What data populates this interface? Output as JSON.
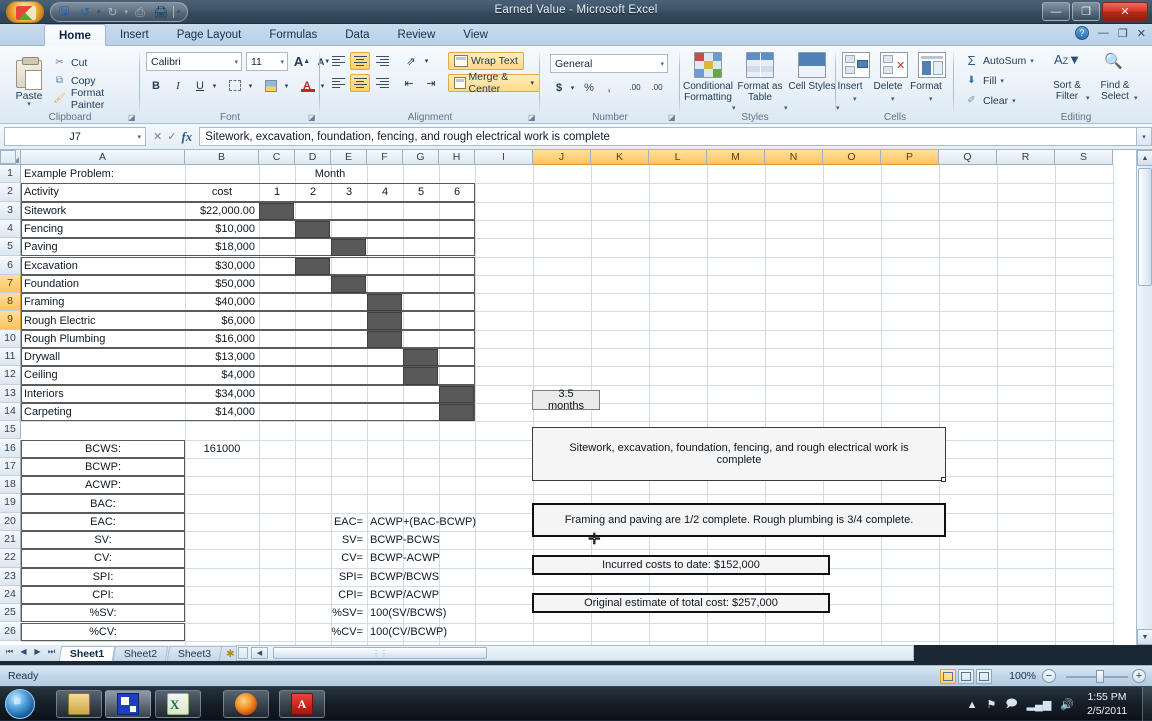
{
  "window": {
    "title": "Earned Value - Microsoft Excel",
    "minimize": "—",
    "restore": "❐",
    "close": "✕"
  },
  "quick_access": {
    "save": "💾",
    "undo": "↺",
    "redo": "↻",
    "print": "🖫",
    "customize": "▾"
  },
  "ribbon": {
    "tabs": [
      {
        "label": "Home",
        "active": true
      },
      {
        "label": "Insert",
        "active": false
      },
      {
        "label": "Page Layout",
        "active": false
      },
      {
        "label": "Formulas",
        "active": false
      },
      {
        "label": "Data",
        "active": false
      },
      {
        "label": "Review",
        "active": false
      },
      {
        "label": "View",
        "active": false
      }
    ],
    "help": "?",
    "minimize_ribbon": "—",
    "restore_window": "❐",
    "close_window": "✕",
    "groups": {
      "clipboard": {
        "name": "Clipboard",
        "paste": "Paste",
        "cut": "Cut",
        "copy": "Copy",
        "format_painter": "Format Painter"
      },
      "font": {
        "name": "Font",
        "font_family": "Calibri",
        "font_size": "11",
        "grow_font": "A",
        "shrink_font": "A",
        "bold": "B",
        "italic": "I",
        "underline": "U"
      },
      "alignment": {
        "name": "Alignment",
        "wrap_text": "Wrap Text",
        "merge_center": "Merge & Center"
      },
      "number": {
        "name": "Number",
        "format": "General",
        "currency": "$",
        "percent": "%",
        "comma": ",",
        "increase_decimal": ".00",
        "decrease_decimal": ".00"
      },
      "styles": {
        "name": "Styles",
        "conditional_formatting": "Conditional Formatting",
        "format_as_table": "Format as Table",
        "cell_styles": "Cell Styles"
      },
      "cells": {
        "name": "Cells",
        "insert": "Insert",
        "delete": "Delete",
        "format": "Format"
      },
      "editing": {
        "name": "Editing",
        "autosum": "AutoSum",
        "fill": "Fill",
        "clear": "Clear",
        "sort_filter": "Sort & Filter",
        "find_select": "Find & Select"
      }
    }
  },
  "formula_bar": {
    "name_box": "J7",
    "cancel": "✕",
    "enter": "✓",
    "insert_function": "fx",
    "content": "Sitework, excavation, foundation, fencing, and rough electrical work is complete",
    "expand": "▾"
  },
  "grid": {
    "columns": [
      "A",
      "B",
      "C",
      "D",
      "E",
      "F",
      "G",
      "H",
      "I",
      "J",
      "K",
      "L",
      "M",
      "N",
      "O",
      "P",
      "Q",
      "R",
      "S"
    ],
    "selected_columns": [
      "J",
      "K",
      "L",
      "M",
      "N",
      "O",
      "P"
    ],
    "rows": [
      1,
      2,
      3,
      4,
      5,
      6,
      7,
      8,
      9,
      10,
      11,
      12,
      13,
      14,
      15,
      16,
      17,
      18,
      19,
      20,
      21,
      22,
      23,
      24,
      25,
      26
    ],
    "selected_rows": [
      7,
      8,
      9
    ],
    "header_title": "Example Problem:",
    "month_label": "Month",
    "table_headers": {
      "activity": "Activity",
      "cost": "cost",
      "months": [
        "1",
        "2",
        "3",
        "4",
        "5",
        "6"
      ]
    },
    "activities": [
      {
        "row": 3,
        "name": "Sitework",
        "cost": "$22,000.00",
        "months": [
          1
        ]
      },
      {
        "row": 4,
        "name": "Fencing",
        "cost": "$10,000",
        "months": [
          2
        ]
      },
      {
        "row": 5,
        "name": "Paving",
        "cost": "$18,000",
        "months": [
          3
        ]
      },
      {
        "row": 6,
        "name": "Excavation",
        "cost": "$30,000",
        "months": [
          2
        ]
      },
      {
        "row": 7,
        "name": "Foundation",
        "cost": "$50,000",
        "months": [
          3
        ]
      },
      {
        "row": 8,
        "name": "Framing",
        "cost": "$40,000",
        "months": [
          4
        ]
      },
      {
        "row": 9,
        "name": "Rough Electric",
        "cost": "$6,000",
        "months": [
          4
        ]
      },
      {
        "row": 10,
        "name": "Rough Plumbing",
        "cost": "$16,000",
        "months": [
          4
        ]
      },
      {
        "row": 11,
        "name": "Drywall",
        "cost": "$13,000",
        "months": [
          5
        ]
      },
      {
        "row": 12,
        "name": "Ceiling",
        "cost": "$4,000",
        "months": [
          5
        ]
      },
      {
        "row": 13,
        "name": "Interiors",
        "cost": "$34,000",
        "months": [
          6
        ]
      },
      {
        "row": 14,
        "name": "Carpeting",
        "cost": "$14,000",
        "months": [
          6
        ]
      }
    ],
    "metrics": [
      {
        "row": 16,
        "label": "BCWS:",
        "value": "161000",
        "formula_key": "",
        "formula": ""
      },
      {
        "row": 17,
        "label": "BCWP:",
        "value": "",
        "formula_key": "",
        "formula": ""
      },
      {
        "row": 18,
        "label": "ACWP:",
        "value": "",
        "formula_key": "",
        "formula": ""
      },
      {
        "row": 19,
        "label": "BAC:",
        "value": "",
        "formula_key": "",
        "formula": ""
      },
      {
        "row": 20,
        "label": "EAC:",
        "value": "",
        "formula_key": "EAC=",
        "formula": "ACWP+(BAC-BCWP)"
      },
      {
        "row": 21,
        "label": "SV:",
        "value": "",
        "formula_key": "SV=",
        "formula": "BCWP-BCWS"
      },
      {
        "row": 22,
        "label": "CV:",
        "value": "",
        "formula_key": "CV=",
        "formula": "BCWP-ACWP"
      },
      {
        "row": 23,
        "label": "SPI:",
        "value": "",
        "formula_key": "SPI=",
        "formula": "BCWP/BCWS"
      },
      {
        "row": 24,
        "label": "CPI:",
        "value": "",
        "formula_key": "CPI=",
        "formula": "BCWP/ACWP"
      },
      {
        "row": 25,
        "label": "%SV:",
        "value": "",
        "formula_key": "%SV=",
        "formula": "100(SV/BCWS)"
      },
      {
        "row": 26,
        "label": "%CV:",
        "value": "",
        "formula_key": "%CV=",
        "formula": "100(CV/BCWP)"
      }
    ],
    "callouts": [
      {
        "id": "duration",
        "text": "3.5 months"
      },
      {
        "id": "completed",
        "text": "Sitework, excavation, foundation, fencing, and rough electrical work is complete"
      },
      {
        "id": "partial",
        "text": "Framing and paving are 1/2 complete. Rough plumbing is 3/4 complete."
      },
      {
        "id": "incurred",
        "text": "Incurred costs to date: $152,000"
      },
      {
        "id": "estimate",
        "text": "Original estimate of total cost: $257,000"
      }
    ]
  },
  "sheet_tabs": {
    "first": "⏮",
    "prev": "◀",
    "next": "▶",
    "last": "⏭",
    "tabs": [
      {
        "label": "Sheet1",
        "active": true
      },
      {
        "label": "Sheet2",
        "active": false
      },
      {
        "label": "Sheet3",
        "active": false
      }
    ],
    "insert_sheet": "✱"
  },
  "status_bar": {
    "mode": "Ready",
    "view_normal": "normal-view",
    "view_layout": "page-layout-view",
    "view_break": "page-break-view",
    "zoom": "100%",
    "zoom_out": "−",
    "zoom_in": "+"
  },
  "taskbar": {
    "start": "start-orb",
    "items": [
      "explorer",
      "application",
      "excel",
      "firefox",
      "acrobat"
    ],
    "tray": [
      "show-hidden-icons",
      "network-flag",
      "action-center",
      "signal",
      "volume"
    ],
    "time": "1:55 PM",
    "date": "2/5/2011"
  },
  "colors": {
    "gantt_fill": "#595959",
    "selection_header": "#ffc45c",
    "title_bar": "#3d5468"
  }
}
